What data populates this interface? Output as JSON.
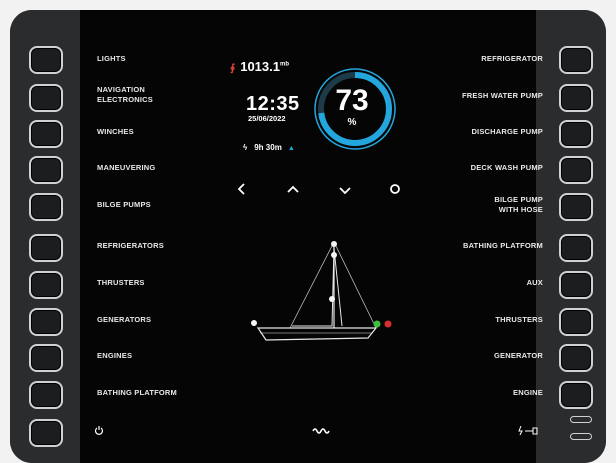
{
  "left_menu": [
    "LIGHTS",
    "NAVIGATION\nELECTRONICS",
    "WINCHES",
    "MANEUVERING",
    "BILGE PUMPS",
    "REFRIGERATORS",
    "THRUSTERS",
    "GENERATORS",
    "ENGINES",
    "BATHING PLATFORM"
  ],
  "right_menu": [
    "REFRIGERATOR",
    "FRESH WATER PUMP",
    "DISCHARGE PUMP",
    "DECK WASH PUMP",
    "BILGE PUMP\nWITH HOSE",
    "BATHING PLATFORM",
    "AUX",
    "THRUSTERS",
    "GENERATOR",
    "ENGINE"
  ],
  "status": {
    "pressure_value": "1013.1",
    "pressure_unit": "mb",
    "time": "12:35",
    "date": "25/06/2022",
    "charge_time": "9h 30m",
    "battery_percent": 73,
    "battery_unit": "%"
  },
  "nav_icons": [
    "chevron-left-icon",
    "chevron-up-icon",
    "chevron-down-icon",
    "refresh-icon"
  ],
  "bottom_icons": [
    "power-icon",
    "waves-icon",
    "charging-plug-icon"
  ],
  "colors": {
    "accent": "#23a6de",
    "arrow_red": "#e0433a",
    "port_light": "#3fbf3f",
    "starboard_light": "#d83030"
  }
}
